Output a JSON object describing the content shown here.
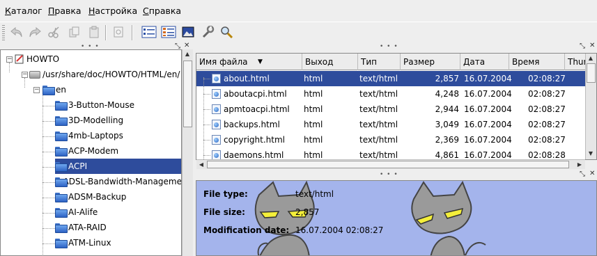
{
  "menu": [
    {
      "label": "Каталог",
      "accel": "К"
    },
    {
      "label": "Правка",
      "accel": "П"
    },
    {
      "label": "Настройка",
      "accel": "Н"
    },
    {
      "label": "Справка",
      "accel": "С"
    }
  ],
  "toolbar": {
    "buttons": [
      "undo-icon",
      "redo-icon",
      "cut-icon",
      "copy-icon",
      "paste-icon",
      "zoom-page-icon",
      "detail-view-icon",
      "list-view-icon",
      "image-view-icon",
      "settings-tools-icon",
      "search-icon"
    ]
  },
  "tree": {
    "root": "HOWTO",
    "path": "/usr/share/doc/HOWTO/HTML/en/",
    "lang": "en",
    "folders": [
      "3-Button-Mouse",
      "3D-Modelling",
      "4mb-Laptops",
      "ACP-Modem",
      "ACPI",
      "ADSL-Bandwidth-Manageme",
      "ADSM-Backup",
      "AI-Alife",
      "ATA-RAID",
      "ATM-Linux"
    ],
    "selected": "ACPI"
  },
  "list": {
    "columns": [
      "Имя файла",
      "Выход",
      "Тип",
      "Размер",
      "Дата",
      "Время",
      "Thum"
    ],
    "rows": [
      {
        "name": "about.html",
        "out": "html",
        "type": "text/html",
        "size": "2,857",
        "date": "16.07.2004",
        "time": "02:08:27"
      },
      {
        "name": "aboutacpi.html",
        "out": "html",
        "type": "text/html",
        "size": "4,248",
        "date": "16.07.2004",
        "time": "02:08:27"
      },
      {
        "name": "apmtoacpi.html",
        "out": "html",
        "type": "text/html",
        "size": "2,944",
        "date": "16.07.2004",
        "time": "02:08:27"
      },
      {
        "name": "backups.html",
        "out": "html",
        "type": "text/html",
        "size": "3,049",
        "date": "16.07.2004",
        "time": "02:08:27"
      },
      {
        "name": "copyright.html",
        "out": "html",
        "type": "text/html",
        "size": "2,369",
        "date": "16.07.2004",
        "time": "02:08:27"
      },
      {
        "name": "daemons.html",
        "out": "html",
        "type": "text/html",
        "size": "4,861",
        "date": "16.07.2004",
        "time": "02:08:28"
      }
    ],
    "selected_index": 0
  },
  "info": {
    "file_type_label": "File type:",
    "file_type": "text/html",
    "file_size_label": "File size:",
    "file_size": "2,857",
    "mod_date_label": "Modification date:",
    "mod_date": "16.07.2004 02:08:27"
  },
  "colors": {
    "selection": "#2e4c9c",
    "info_background": "#a4b4ec",
    "cat_body": "#9a9a9a",
    "cat_eyes": "#f4ef3a"
  }
}
